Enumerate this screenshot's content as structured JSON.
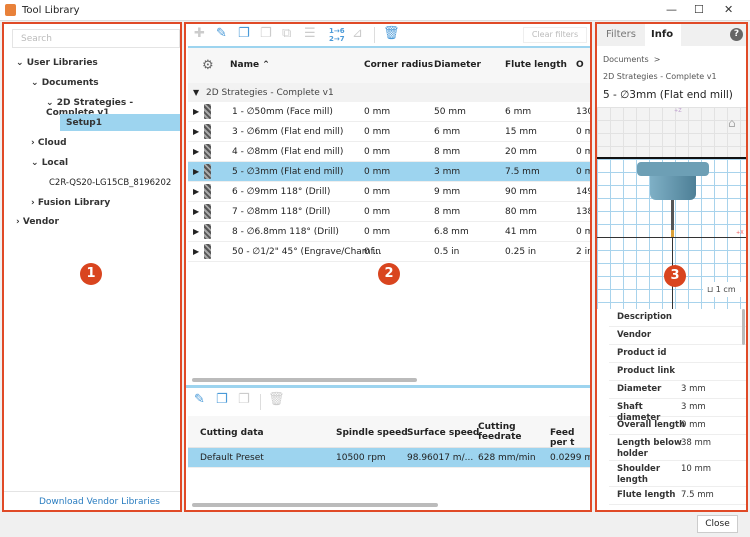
{
  "window": {
    "title": "Tool Library",
    "close_label": "Close"
  },
  "left": {
    "search_placeholder": "Search",
    "tree": [
      "User Libraries",
      "Documents",
      "2D Strategies - Complete v1",
      "Setup1",
      "Cloud",
      "Local",
      "C2R-QS20-LG15CB_8196202",
      "Fusion Library",
      "Vendor"
    ],
    "download_link": "Download Vendor Libraries",
    "badge": "1"
  },
  "middle": {
    "clear_filters": "Clear filters",
    "columns": [
      "Name",
      "Corner radius",
      "Diameter",
      "Flute length",
      "O"
    ],
    "group": "2D Strategies - Complete v1",
    "rows": [
      [
        "1 - ∅50mm (Face mill)",
        "0 mm",
        "50 mm",
        "6 mm",
        "130"
      ],
      [
        "3 - ∅6mm (Flat end mill)",
        "0 mm",
        "6 mm",
        "15 mm",
        "0 m"
      ],
      [
        "4 - ∅8mm (Flat end mill)",
        "0 mm",
        "8 mm",
        "20 mm",
        "0 m"
      ],
      [
        "5 - ∅3mm (Flat end mill)",
        "0 mm",
        "3 mm",
        "7.5 mm",
        "0 m"
      ],
      [
        "6 - ∅9mm 118° (Drill)",
        "0 mm",
        "9 mm",
        "90 mm",
        "149"
      ],
      [
        "7 - ∅8mm 118° (Drill)",
        "0 mm",
        "8 mm",
        "80 mm",
        "138"
      ],
      [
        "8 - ∅6.8mm 118° (Drill)",
        "0 mm",
        "6.8 mm",
        "41 mm",
        "0 m"
      ],
      [
        "50 - ∅1/2\" 45° (Engrave/Chamf...",
        "0 in",
        "0.5 in",
        "0.25 in",
        "2 in"
      ]
    ],
    "selected_row": 3,
    "cutting_columns": [
      "Cutting data",
      "Spindle speed",
      "Surface speed",
      "Cutting feedrate",
      "Feed per t"
    ],
    "cutting_rows": [
      [
        "Default Preset",
        "10500 rpm",
        "98.96017 m/...",
        "628 mm/min",
        "0.0299 mm"
      ]
    ],
    "badge": "2"
  },
  "right": {
    "tabs": [
      "Filters",
      "Info"
    ],
    "active_tab": "Info",
    "breadcrumb": "Documents",
    "breadcrumb_sep": ">",
    "subtitle": "2D Strategies - Complete v1",
    "title": "5 - ∅3mm (Flat end mill)",
    "scale": "1 cm",
    "axis_z": "+Z",
    "axis_x": "+X",
    "badge": "3",
    "props": [
      [
        "Description",
        ""
      ],
      [
        "Vendor",
        ""
      ],
      [
        "Product id",
        ""
      ],
      [
        "Product link",
        ""
      ],
      [
        "Diameter",
        "3 mm"
      ],
      [
        "Shaft diameter",
        "3 mm"
      ],
      [
        "Overall length",
        "0 mm"
      ],
      [
        "Length below holder",
        "38 mm"
      ],
      [
        "Shoulder length",
        "10 mm"
      ],
      [
        "Flute length",
        "7.5 mm"
      ]
    ]
  }
}
